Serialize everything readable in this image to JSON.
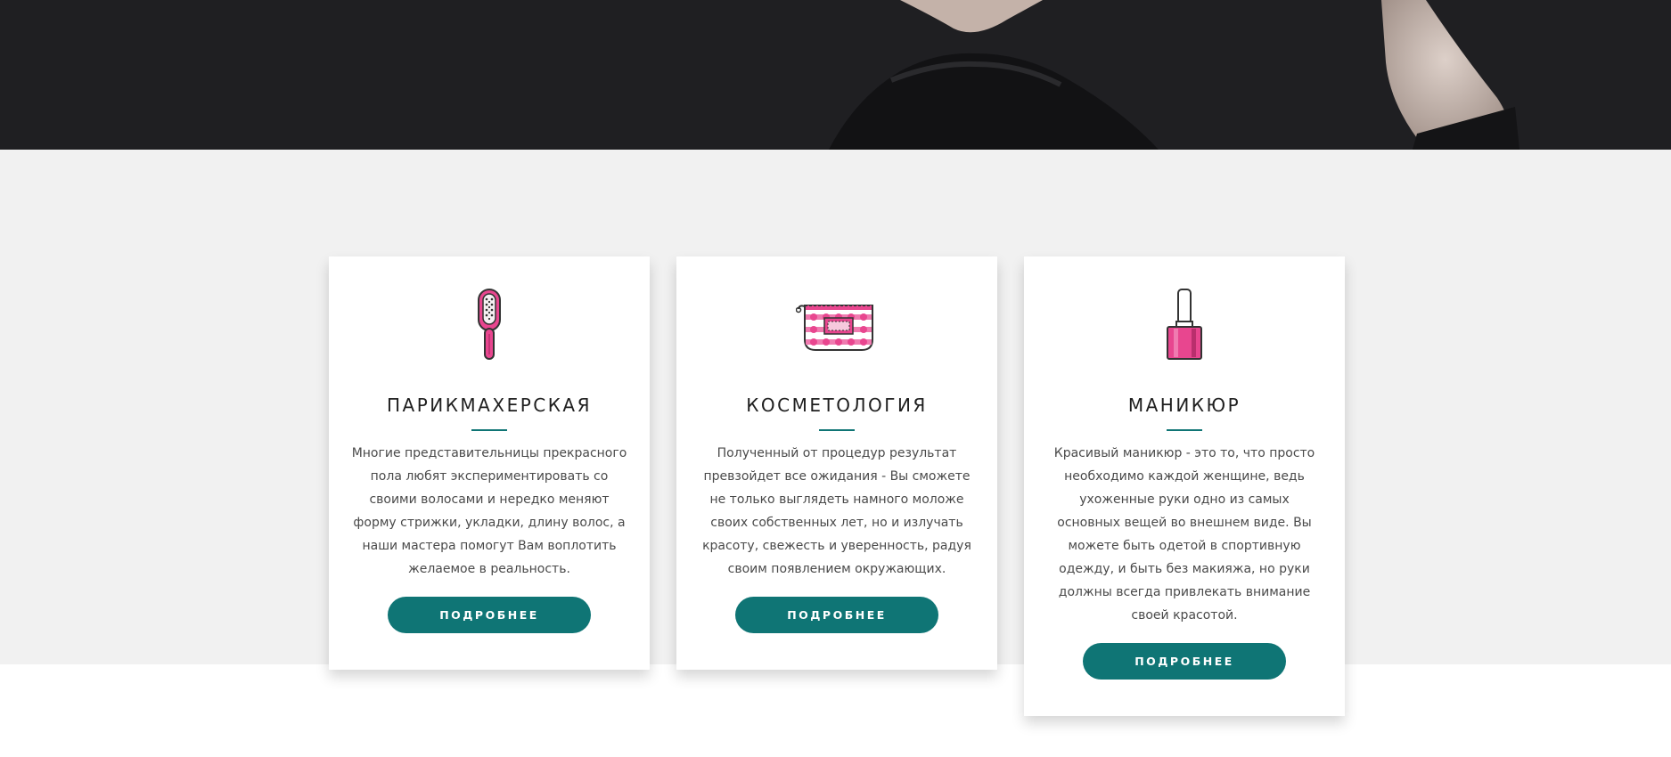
{
  "hero": {
    "image": "woman-in-black-hat-photo"
  },
  "services": [
    {
      "icon": "hairbrush-icon",
      "title": "ПАРИКМАХЕРСКАЯ",
      "text": "Многие представительницы прекрасного пола любят экспериментировать со своими волосами и нередко меняют форму стрижки, укладки, длину волос, а наши мастера помогут Вам воплотить желаемое в реальность.",
      "button": "ПОДРОБНЕЕ"
    },
    {
      "icon": "cosmetic-bag-icon",
      "title": "КОСМЕТОЛОГИЯ",
      "text": "Полученный от процедур результат превзойдет все ожидания - Вы сможете не только выглядеть намного моложе своих собственных лет, но и излучать красоту, свежесть и уверенность, радуя своим появлением окружающих.",
      "button": "ПОДРОБНЕЕ"
    },
    {
      "icon": "nail-polish-icon",
      "title": "МАНИКЮР",
      "text": "Красивый маникюр - это то, что просто необходимо каждой женщине, ведь ухоженные руки одно из самых основных вещей во внешнем виде. Вы можете быть одетой в спортивную одежду, и быть без макияжа, но руки должны всегда привлекать внимание своей красотой.",
      "button": "ПОДРОБНЕЕ"
    }
  ],
  "colors": {
    "accent": "#0f7575",
    "icon_pink": "#e8468f",
    "band": "#f1f1f1",
    "hero": "#1d1d1f"
  }
}
